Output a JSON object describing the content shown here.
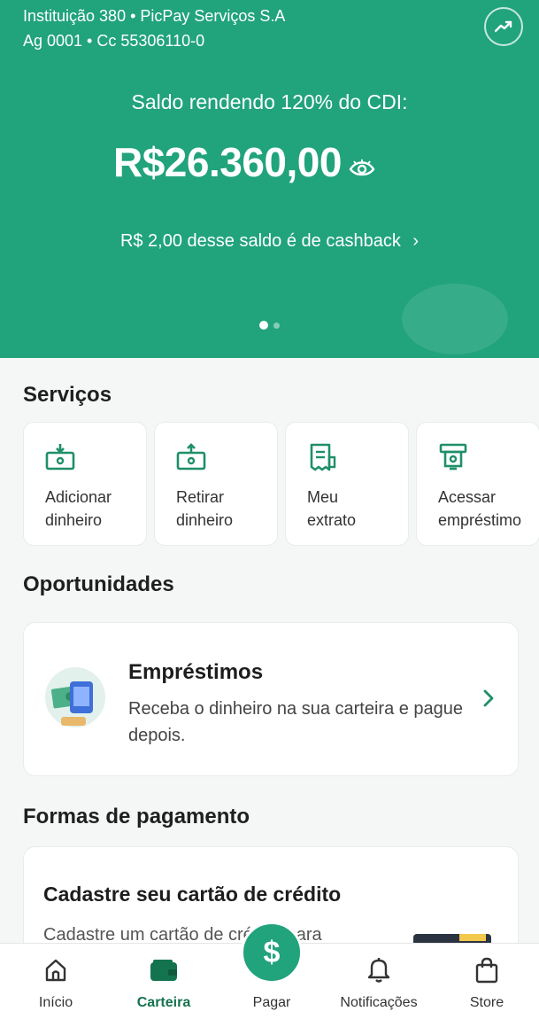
{
  "header": {
    "bank_line_1": "Instituição 380 • PicPay Serviços S.A",
    "bank_line_2": "Ag 0001 • Cc 55306110-0",
    "balance_label": "Saldo rendendo 120% do CDI:",
    "balance_amount": "R$26.360,00",
    "cashback_text": "R$ 2,00 desse saldo é de cashback",
    "carousel_page": 1,
    "carousel_total": 2,
    "colors": {
      "primary": "#21a37c"
    }
  },
  "services": {
    "title": "Serviços",
    "items": [
      {
        "label": "Adicionar\ndinheiro",
        "icon": "add-money-icon"
      },
      {
        "label": "Retirar\ndinheiro",
        "icon": "withdraw-money-icon"
      },
      {
        "label": "Meu\nextrato",
        "icon": "statement-icon"
      },
      {
        "label": "Acessar\nempréstimo",
        "icon": "loan-icon"
      }
    ]
  },
  "opportunities": {
    "title": "Oportunidades",
    "card": {
      "title": "Empréstimos",
      "description": "Receba o dinheiro na sua carteira e pague depois."
    }
  },
  "payment_methods": {
    "title": "Formas de pagamento",
    "card": {
      "title": "Cadastre seu cartão de crédito",
      "description_partial": "Cadastre um cartão de crédito para"
    }
  },
  "bottom_nav": {
    "items": [
      {
        "label": "Início",
        "icon": "home-icon"
      },
      {
        "label": "Carteira",
        "icon": "wallet-icon",
        "active": true
      },
      {
        "label": "Pagar",
        "icon": "dollar-icon"
      },
      {
        "label": "Notificações",
        "icon": "bell-icon"
      },
      {
        "label": "Store",
        "icon": "shopping-bag-icon"
      }
    ]
  }
}
